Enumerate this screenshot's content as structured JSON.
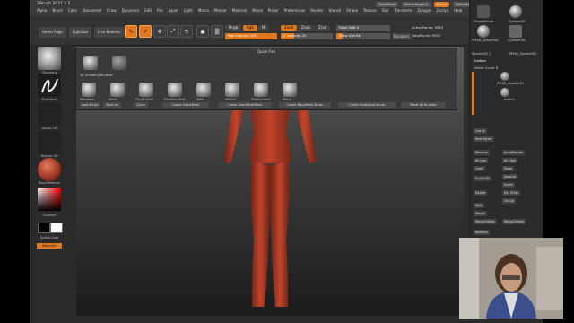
{
  "app": {
    "title": "ZBrush 2021.5.1",
    "menus": [
      "Alpha",
      "Brush",
      "Color",
      "Document",
      "Draw",
      "Dynamics",
      "Edit",
      "File",
      "Layer",
      "Light",
      "Macro",
      "Marker",
      "Material",
      "Movie",
      "Picker",
      "Preferences",
      "Render",
      "Stencil",
      "Stroke",
      "Texture",
      "Tool",
      "Transform",
      "Zplugin",
      "Zscript",
      "Help"
    ],
    "top_right": {
      "quicksave": "QuickSave",
      "see_through": "See-through 0",
      "menus": "Menus",
      "default_script": "DefaultZScript"
    }
  },
  "toolbar": {
    "home_page": "Home Page",
    "lightbox": "LightBox",
    "live_boolean": "Live Boolean",
    "edit": "Edit",
    "draw": "Draw",
    "move": "Move",
    "scale": "Scale",
    "rotate": "Rotate",
    "mrgb": "Mrgb",
    "rgb": "Rgb",
    "m": "M",
    "rgb_intensity": "Rgb Intensity 100",
    "zadd": "Zadd",
    "zsub": "Zsub",
    "zcut": "Zcut",
    "z_intensity": "Z Intensity 25",
    "focal_shift": "Focal Shift 0",
    "draw_size": "Draw Size 64",
    "dynamic": "Dynamic",
    "active_points": "ActivePoints: 9502",
    "total_points": "TotalPoints: 9502"
  },
  "left_panel": {
    "brush": "Standard",
    "stroke": "FreeHand",
    "alpha": "Alpha Off",
    "texture": "Texture Off",
    "material": "BasicMaterial",
    "gradient": "Gradient",
    "switch_color": "SwitchColor",
    "alternate": "Alternate"
  },
  "quick_pick": {
    "title": "Quick Pick",
    "section": "3D Sculpting Brushes",
    "brushes": [
      "Standard",
      "Move",
      "ClayBuildup",
      "DamStandard",
      "Inflat",
      "hPolish",
      "TrimDynamic",
      "Pinch"
    ],
    "buttons": [
      "Load Brush",
      "Save As",
      "Clone",
      "Create InsertMesh",
      "Create InsertMultiMesh",
      "Create NanoMesh Brush",
      "Create MultiAlpha Brush",
      "Reset All Brushes"
    ]
  },
  "right_dock": [
    "Bpr",
    "SPix 3",
    "Scroll",
    "Zoom",
    "Actual",
    "AAHalf",
    "Persp",
    "Floor",
    "Local",
    "L.Sym",
    "Frame",
    "Move",
    "Zoom3D",
    "Rotate",
    "Line Fill",
    "PolyF",
    "Transp",
    "Ghost",
    "Solo",
    "Xpose"
  ],
  "right_panel": {
    "tools": [
      "SimpleBrush",
      "Sphere3D",
      "PM3D_Sphere3D",
      "Cylinder3D",
      "Sphere3D_1",
      "PM3D_Sphere3D"
    ],
    "subtool_header": "Subtool",
    "visible_count": "Visible Count 8",
    "subtool_items": [
      "PM3D_Sphere3D",
      "mesh1"
    ],
    "buttons": [
      "List All",
      "New Folder",
      "Rename",
      "AutoReorder",
      "All Low",
      "All High",
      "Copy",
      "Paste",
      "Append",
      "Insert",
      "Duplicate",
      "Del Other",
      "Delete",
      "Del All",
      "Split",
      "Merge",
      "MergeVisible",
      "MergeSimilar",
      "Boolean"
    ]
  },
  "colors": {
    "accent": "#e0781f",
    "skin": "#c0452c",
    "panel": "#2b2b2b"
  }
}
